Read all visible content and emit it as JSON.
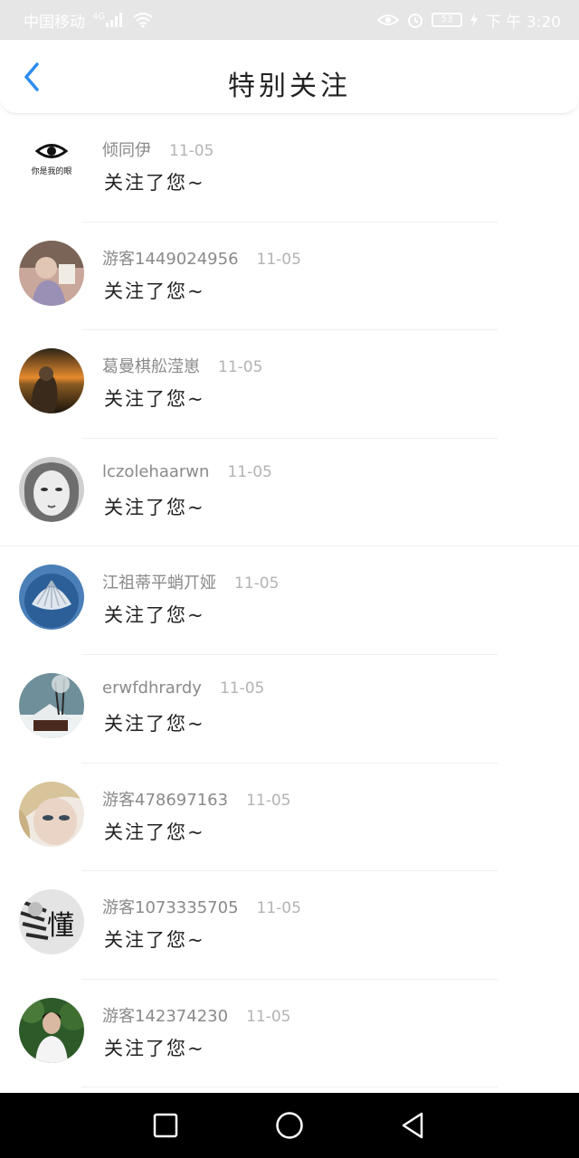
{
  "status_bar": {
    "carrier": "中国移动",
    "network": "4G",
    "battery": "53",
    "time": "下 午 3:20",
    "icons": [
      "signal-icon",
      "wifi-icon",
      "eye-icon",
      "alarm-icon",
      "battery-icon",
      "charging-icon"
    ]
  },
  "header": {
    "title": "特别关注",
    "back_icon": "chevron-left-icon"
  },
  "colors": {
    "accent": "#2d8cf0",
    "text": "#222222",
    "muted": "#8a8a8a",
    "date": "#b3b3b3"
  },
  "logo": {
    "caption": "你是我的眼"
  },
  "list": [
    {
      "name": "倾同伊",
      "date": "11-05",
      "message": "关注了您~",
      "avatar": "eye-logo"
    },
    {
      "name": "游客1449024956",
      "date": "11-05",
      "message": "关注了您~",
      "avatar": "photo-girl-reading"
    },
    {
      "name": "葛曼棋舩滢崽",
      "date": "11-05",
      "message": "关注了您~",
      "avatar": "photo-sunset-man"
    },
    {
      "name": "lczolehaarwn",
      "date": "11-05",
      "message": "关注了您~",
      "avatar": "photo-pale-face"
    },
    {
      "name": "江祖蒂平蛸丌娅",
      "date": "11-05",
      "message": "关注了您~",
      "avatar": "photo-shell"
    },
    {
      "name": "erwfdhrardy",
      "date": "11-05",
      "message": "关注了您~",
      "avatar": "photo-snow-cabin"
    },
    {
      "name": "游客478697163",
      "date": "11-05",
      "message": "关注了您~",
      "avatar": "photo-blonde-girl"
    },
    {
      "name": "游客1073335705",
      "date": "11-05",
      "message": "关注了您~",
      "avatar": "photo-dong-character",
      "avatar_char": "懂"
    },
    {
      "name": "游客142374230",
      "date": "11-05",
      "message": "关注了您~",
      "avatar": "photo-girl-garden"
    }
  ],
  "nav_bar": {
    "icons": [
      "recent-apps-icon",
      "home-icon",
      "back-icon"
    ]
  }
}
